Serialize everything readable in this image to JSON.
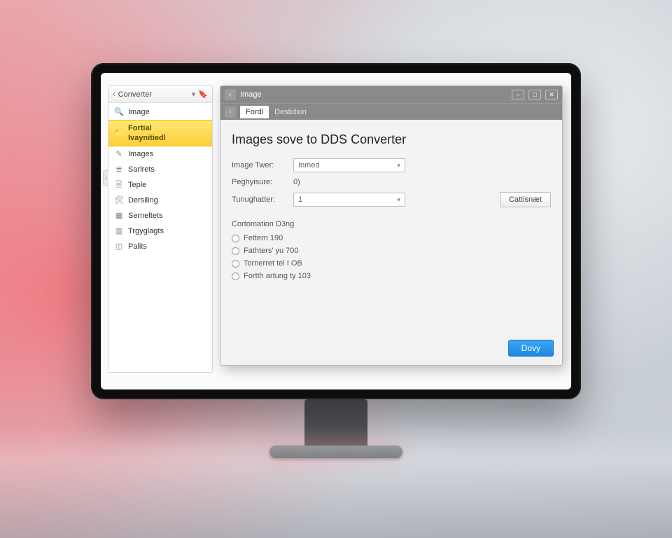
{
  "sidebar": {
    "header": {
      "back_glyph": "‹",
      "title": "Converter",
      "caret_glyph": "▾",
      "bookmark_glyph": "🔖"
    },
    "items": [
      {
        "icon": "search-icon",
        "glyph": "🔍",
        "label": "Image"
      },
      {
        "icon": "folder-icon",
        "glyph": "📁",
        "label": "Fortial\nIvaynitiedl",
        "active": true
      },
      {
        "icon": "pencil-icon",
        "glyph": "✎",
        "label": "Images"
      },
      {
        "icon": "sliders-icon",
        "glyph": "≣",
        "label": "Sarlrets"
      },
      {
        "icon": "page-icon",
        "glyph": "🗎",
        "label": "Teple"
      },
      {
        "icon": "tools-icon",
        "glyph": "🛠",
        "label": "Dersiling"
      },
      {
        "icon": "grid-icon",
        "glyph": "▦",
        "label": "Serneltets"
      },
      {
        "icon": "calendar-icon",
        "glyph": "▥",
        "label": "Trgyglagts"
      },
      {
        "icon": "chart-icon",
        "glyph": "◫",
        "label": "Palits"
      }
    ],
    "collapse_glyph": "‹"
  },
  "dialog": {
    "window_title": "Image",
    "back_glyph": "‹",
    "controls": {
      "min": "–",
      "max": "□",
      "close": "✕"
    },
    "tabs": {
      "back_glyph": "‹",
      "items": [
        {
          "label": "Fordl",
          "active": true
        },
        {
          "label": "Destidion",
          "active": false
        }
      ]
    },
    "heading": "Images sove to DDS Converter",
    "fields": {
      "image_type": {
        "label": "Image Twer:",
        "value": "Inmed"
      },
      "registration": {
        "label": "Peghyisure:",
        "value": "0)"
      },
      "throughput": {
        "label": "Tunughatter:",
        "value": "1"
      }
    },
    "side_button_label": "Cattisnæt",
    "options": {
      "section_label": "Cortomation D3ng",
      "radios": [
        "Fettern 190",
        "Fathters' yu 700",
        "Tornerret tel I OB",
        "Fortth artung ty 103"
      ]
    },
    "primary_button_label": "Dovy"
  }
}
